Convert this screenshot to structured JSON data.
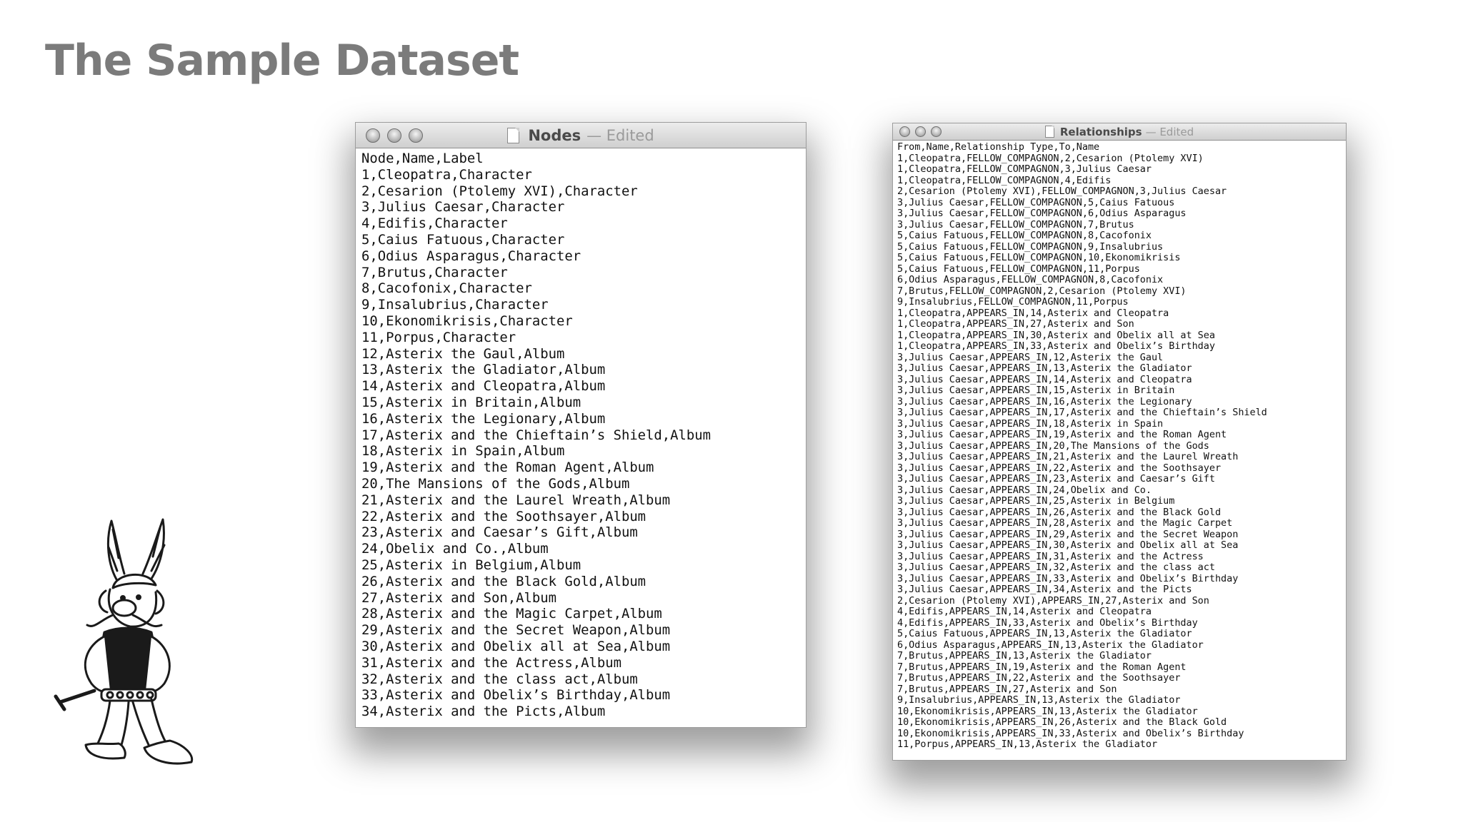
{
  "slide": {
    "title": "The Sample Dataset"
  },
  "illustration": {
    "icon": "asterix-character-illustration"
  },
  "nodes_window": {
    "title": "Nodes",
    "status": "— Edited",
    "lines": [
      "Node,Name,Label",
      "1,Cleopatra,Character",
      "2,Cesarion (Ptolemy XVI),Character",
      "3,Julius Caesar,Character",
      "4,Edifis,Character",
      "5,Caius Fatuous,Character",
      "6,Odius Asparagus,Character",
      "7,Brutus,Character",
      "8,Cacofonix,Character",
      "9,Insalubrius,Character",
      "10,Ekonomikrisis,Character",
      "11,Porpus,Character",
      "12,Asterix the Gaul,Album",
      "13,Asterix the Gladiator,Album",
      "14,Asterix and Cleopatra,Album",
      "15,Asterix in Britain,Album",
      "16,Asterix the Legionary,Album",
      "17,Asterix and the Chieftain’s Shield,Album",
      "18,Asterix in Spain,Album",
      "19,Asterix and the Roman Agent,Album",
      "20,The Mansions of the Gods,Album",
      "21,Asterix and the Laurel Wreath,Album",
      "22,Asterix and the Soothsayer,Album",
      "23,Asterix and Caesar’s Gift,Album",
      "24,Obelix and Co.,Album",
      "25,Asterix in Belgium,Album",
      "26,Asterix and the Black Gold,Album",
      "27,Asterix and Son,Album",
      "28,Asterix and the Magic Carpet,Album",
      "29,Asterix and the Secret Weapon,Album",
      "30,Asterix and Obelix all at Sea,Album",
      "31,Asterix and the Actress,Album",
      "32,Asterix and the class act,Album",
      "33,Asterix and Obelix’s Birthday,Album",
      "34,Asterix and the Picts,Album"
    ]
  },
  "relationships_window": {
    "title": "Relationships",
    "status": "— Edited",
    "lines": [
      "From,Name,Relationship Type,To,Name",
      "1,Cleopatra,FELLOW_COMPAGNON,2,Cesarion (Ptolemy XVI)",
      "1,Cleopatra,FELLOW_COMPAGNON,3,Julius Caesar",
      "1,Cleopatra,FELLOW_COMPAGNON,4,Edifis",
      "2,Cesarion (Ptolemy XVI),FELLOW_COMPAGNON,3,Julius Caesar",
      "3,Julius Caesar,FELLOW_COMPAGNON,5,Caius Fatuous",
      "3,Julius Caesar,FELLOW_COMPAGNON,6,Odius Asparagus",
      "3,Julius Caesar,FELLOW_COMPAGNON,7,Brutus",
      "5,Caius Fatuous,FELLOW_COMPAGNON,8,Cacofonix",
      "5,Caius Fatuous,FELLOW_COMPAGNON,9,Insalubrius",
      "5,Caius Fatuous,FELLOW_COMPAGNON,10,Ekonomikrisis",
      "5,Caius Fatuous,FELLOW_COMPAGNON,11,Porpus",
      "6,Odius Asparagus,FELLOW_COMPAGNON,8,Cacofonix",
      "7,Brutus,FELLOW_COMPAGNON,2,Cesarion (Ptolemy XVI)",
      "9,Insalubrius,FELLOW_COMPAGNON,11,Porpus",
      "1,Cleopatra,APPEARS_IN,14,Asterix and Cleopatra",
      "1,Cleopatra,APPEARS_IN,27,Asterix and Son",
      "1,Cleopatra,APPEARS_IN,30,Asterix and Obelix all at Sea",
      "1,Cleopatra,APPEARS_IN,33,Asterix and Obelix’s Birthday",
      "3,Julius Caesar,APPEARS_IN,12,Asterix the Gaul",
      "3,Julius Caesar,APPEARS_IN,13,Asterix the Gladiator",
      "3,Julius Caesar,APPEARS_IN,14,Asterix and Cleopatra",
      "3,Julius Caesar,APPEARS_IN,15,Asterix in Britain",
      "3,Julius Caesar,APPEARS_IN,16,Asterix the Legionary",
      "3,Julius Caesar,APPEARS_IN,17,Asterix and the Chieftain’s Shield",
      "3,Julius Caesar,APPEARS_IN,18,Asterix in Spain",
      "3,Julius Caesar,APPEARS_IN,19,Asterix and the Roman Agent",
      "3,Julius Caesar,APPEARS_IN,20,The Mansions of the Gods",
      "3,Julius Caesar,APPEARS_IN,21,Asterix and the Laurel Wreath",
      "3,Julius Caesar,APPEARS_IN,22,Asterix and the Soothsayer",
      "3,Julius Caesar,APPEARS_IN,23,Asterix and Caesar’s Gift",
      "3,Julius Caesar,APPEARS_IN,24,Obelix and Co.",
      "3,Julius Caesar,APPEARS_IN,25,Asterix in Belgium",
      "3,Julius Caesar,APPEARS_IN,26,Asterix and the Black Gold",
      "3,Julius Caesar,APPEARS_IN,28,Asterix and the Magic Carpet",
      "3,Julius Caesar,APPEARS_IN,29,Asterix and the Secret Weapon",
      "3,Julius Caesar,APPEARS_IN,30,Asterix and Obelix all at Sea",
      "3,Julius Caesar,APPEARS_IN,31,Asterix and the Actress",
      "3,Julius Caesar,APPEARS_IN,32,Asterix and the class act",
      "3,Julius Caesar,APPEARS_IN,33,Asterix and Obelix’s Birthday",
      "3,Julius Caesar,APPEARS_IN,34,Asterix and the Picts",
      "2,Cesarion (Ptolemy XVI),APPEARS_IN,27,Asterix and Son",
      "4,Edifis,APPEARS_IN,14,Asterix and Cleopatra",
      "4,Edifis,APPEARS_IN,33,Asterix and Obelix’s Birthday",
      "5,Caius Fatuous,APPEARS_IN,13,Asterix the Gladiator",
      "6,Odius Asparagus,APPEARS_IN,13,Asterix the Gladiator",
      "7,Brutus,APPEARS_IN,13,Asterix the Gladiator",
      "7,Brutus,APPEARS_IN,19,Asterix and the Roman Agent",
      "7,Brutus,APPEARS_IN,22,Asterix and the Soothsayer",
      "7,Brutus,APPEARS_IN,27,Asterix and Son",
      "9,Insalubrius,APPEARS_IN,13,Asterix the Gladiator",
      "10,Ekonomikrisis,APPEARS_IN,13,Asterix the Gladiator",
      "10,Ekonomikrisis,APPEARS_IN,26,Asterix and the Black Gold",
      "10,Ekonomikrisis,APPEARS_IN,33,Asterix and Obelix’s Birthday",
      "11,Porpus,APPEARS_IN,13,Asterix the Gladiator"
    ]
  }
}
